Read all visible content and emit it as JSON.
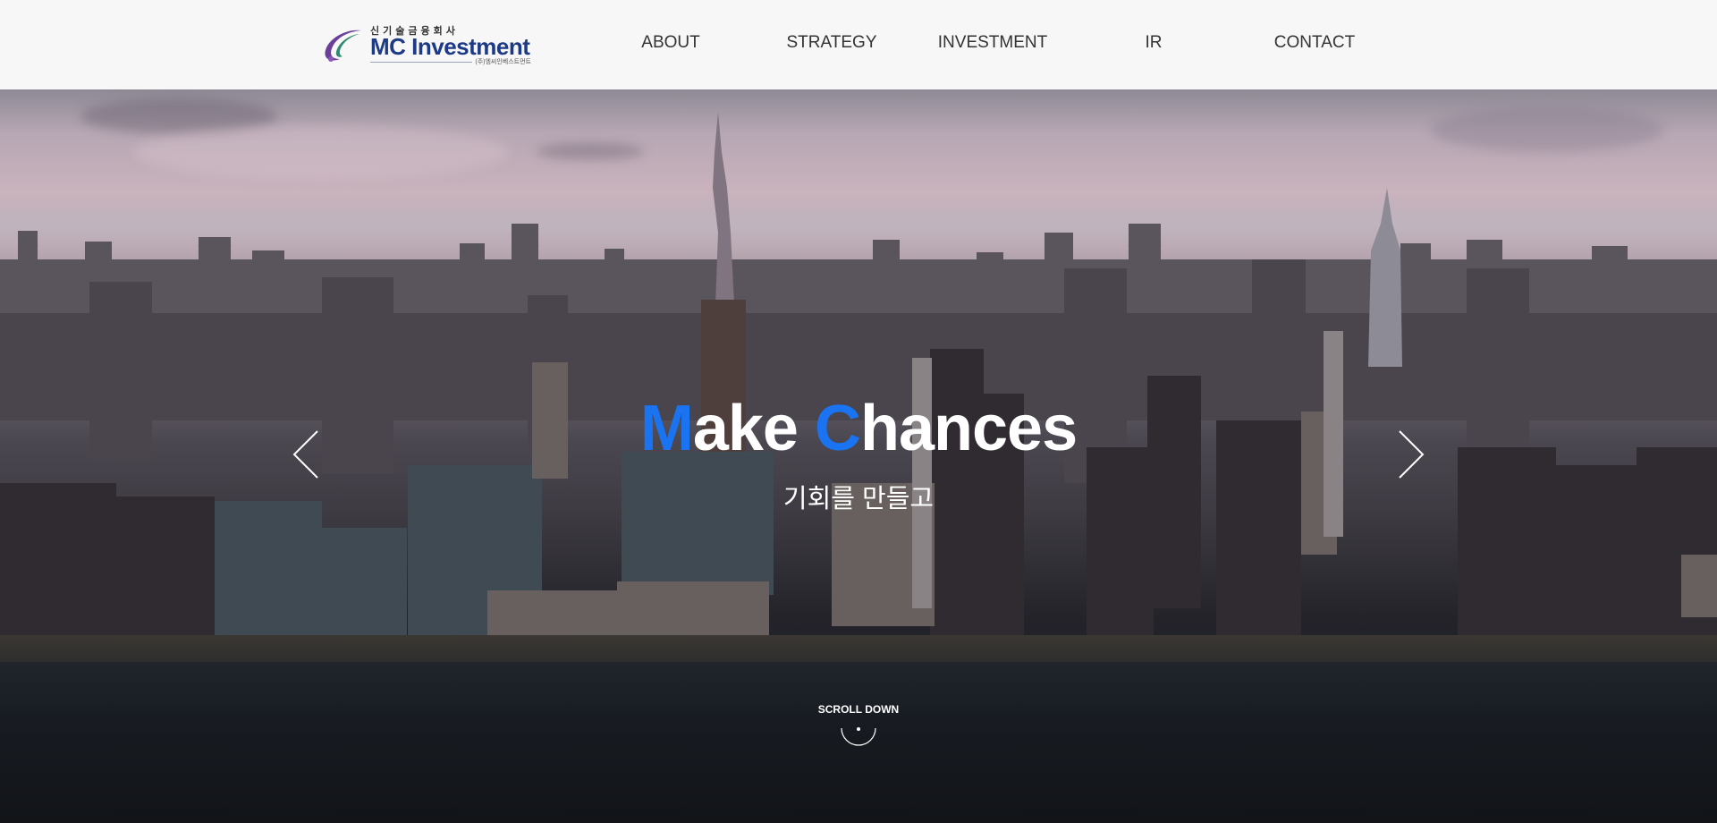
{
  "header": {
    "logo": {
      "korean_name": "신기술금융회사",
      "name": "MC Investment",
      "sub": "(주)엠씨인베스트먼트"
    },
    "nav": [
      {
        "label": "ABOUT"
      },
      {
        "label": "STRATEGY"
      },
      {
        "label": "INVESTMENT"
      },
      {
        "label": "IR"
      },
      {
        "label": "CONTACT"
      }
    ]
  },
  "hero": {
    "headline": {
      "word1_initial": "M",
      "word1_rest": "ake ",
      "word2_initial": "C",
      "word2_rest": "hances"
    },
    "subline": "기회를 만들고",
    "scroll_label": "SCROLL DOWN"
  },
  "colors": {
    "accent": "#1a73f0",
    "brand_navy": "#1c3a86",
    "header_bg": "#f7f7f8"
  },
  "icons": [
    "logo-swoosh-icon",
    "chevron-left-icon",
    "chevron-right-icon",
    "scroll-down-icon"
  ]
}
